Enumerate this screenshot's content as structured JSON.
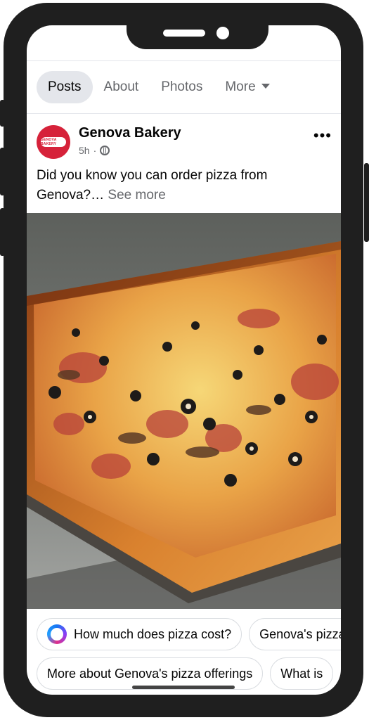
{
  "tabs": [
    {
      "label": "Posts"
    },
    {
      "label": "About"
    },
    {
      "label": "Photos"
    },
    {
      "label": "More"
    }
  ],
  "post": {
    "page_name": "Genova Bakery",
    "avatar_text": "GENOVA BAKERY",
    "time": "5h",
    "separator": "·",
    "text": "Did you know you can order pizza from Genova?…",
    "see_more": "See more",
    "menu_icon": "more-horizontal-icon",
    "privacy_icon": "globe-icon"
  },
  "suggestions": {
    "row1": [
      "How much does pizza cost?",
      "Genova's pizza"
    ],
    "row2": [
      "More about Genova's pizza offerings",
      "What is"
    ]
  },
  "colors": {
    "brand_red": "#d6223a",
    "active_tab_bg": "#e4e6eb",
    "muted_text": "#65676b"
  }
}
